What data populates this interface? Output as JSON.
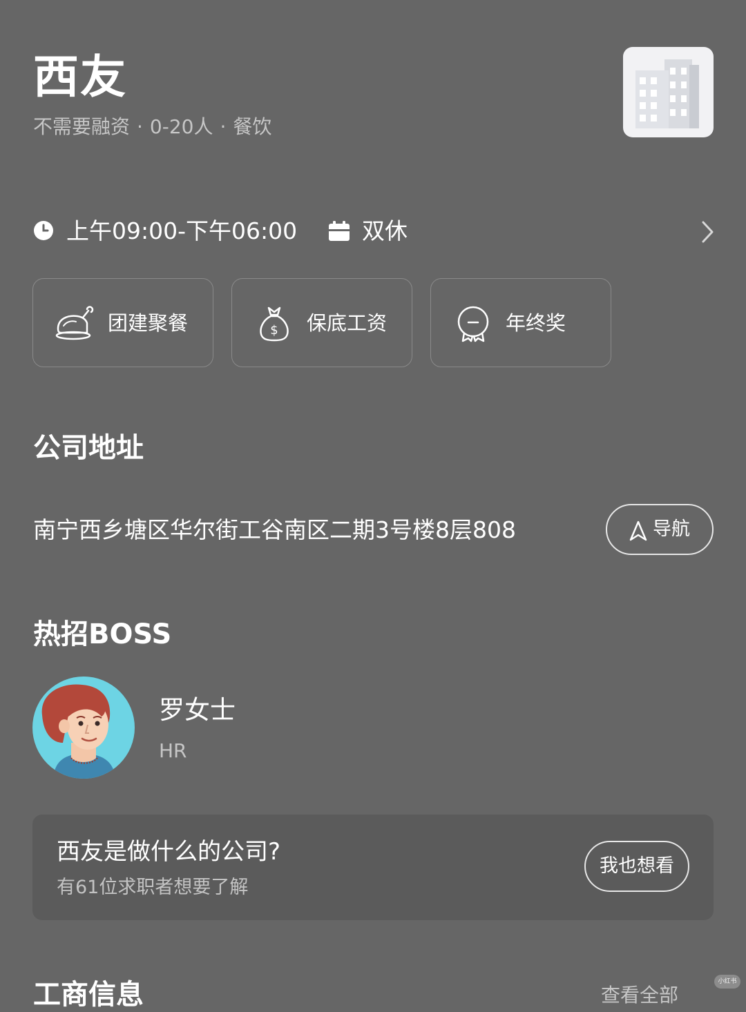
{
  "company": {
    "name": "西友",
    "funding": "不需要融资",
    "size": "0-20人",
    "industry": "餐饮",
    "separator": "·",
    "logo_icon": "building-icon"
  },
  "schedule": {
    "hours": "上午09:00-下午06:00",
    "rest": "双休",
    "hours_icon": "clock-icon",
    "rest_icon": "calendar-icon"
  },
  "benefits": [
    {
      "label": "团建聚餐",
      "icon": "dinner-icon"
    },
    {
      "label": "保底工资",
      "icon": "money-bag-icon"
    },
    {
      "label": "年终奖",
      "icon": "medal-icon"
    }
  ],
  "address_section": {
    "title": "公司地址",
    "address": "南宁西乡塘区华尔街工谷南区二期3号楼8层808",
    "nav_label": "导航"
  },
  "boss_section": {
    "title": "热招BOSS",
    "name": "罗女士",
    "role": "HR"
  },
  "faq": {
    "question": "西友是做什么的公司?",
    "subtitle": "有61位求职者想要了解",
    "button": "我也想看"
  },
  "next_section": {
    "title": "工商信息",
    "right": "查看全部"
  },
  "watermark": "小红书",
  "colors": {
    "background": "#666666",
    "card": "#5b5b5b",
    "text_primary": "#ffffff",
    "text_secondary": "#c6c6c6"
  }
}
